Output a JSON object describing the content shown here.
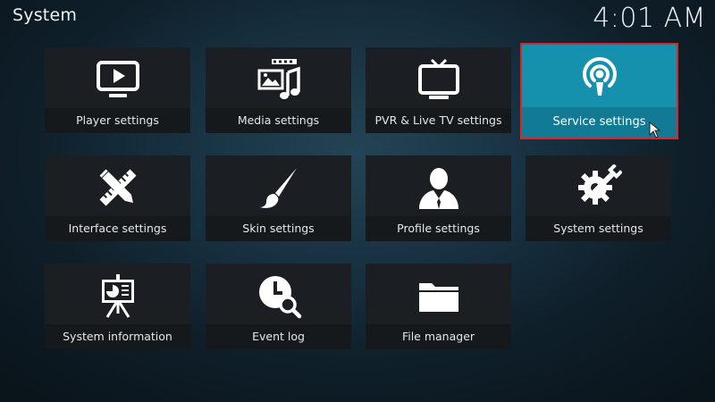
{
  "header": {
    "title": "System",
    "clock": "4:01 AM"
  },
  "colors": {
    "selected_tile": "#1591ae",
    "selected_border": "#d8262e",
    "tile": "#1b1f23"
  },
  "tiles": [
    {
      "label": "Player settings",
      "icon": "player-icon"
    },
    {
      "label": "Media settings",
      "icon": "media-icon"
    },
    {
      "label": "PVR & Live TV settings",
      "icon": "tv-icon"
    },
    {
      "label": "Service settings",
      "icon": "podcast-icon",
      "selected": true
    },
    {
      "label": "Interface settings",
      "icon": "interface-icon"
    },
    {
      "label": "Skin settings",
      "icon": "paintbrush-icon"
    },
    {
      "label": "Profile settings",
      "icon": "profile-icon"
    },
    {
      "label": "System settings",
      "icon": "gear-wrench-icon"
    },
    {
      "label": "System information",
      "icon": "presentation-icon"
    },
    {
      "label": "Event log",
      "icon": "clock-search-icon"
    },
    {
      "label": "File manager",
      "icon": "folder-icon"
    }
  ]
}
